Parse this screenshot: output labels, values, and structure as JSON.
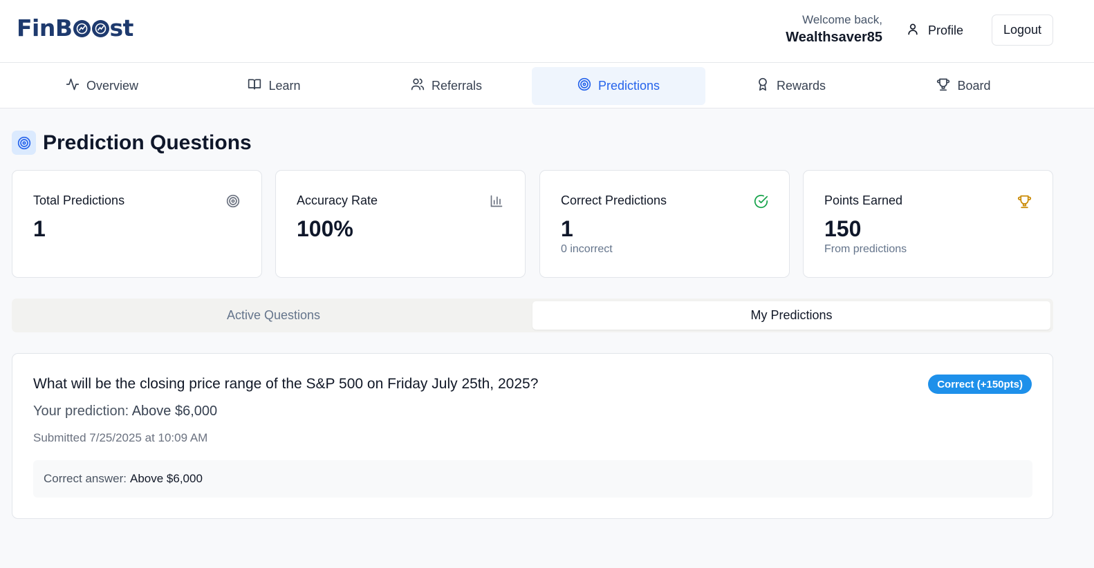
{
  "header": {
    "logo": "FinBoost",
    "welcome_line": "Welcome back,",
    "username": "Wealthsaver85",
    "profile_label": "Profile",
    "logout_label": "Logout"
  },
  "nav": {
    "items": [
      {
        "label": "Overview",
        "icon": "activity-icon"
      },
      {
        "label": "Learn",
        "icon": "book-icon"
      },
      {
        "label": "Referrals",
        "icon": "users-icon"
      },
      {
        "label": "Predictions",
        "icon": "target-icon",
        "active": true
      },
      {
        "label": "Rewards",
        "icon": "award-icon"
      },
      {
        "label": "Board",
        "icon": "trophy-icon"
      }
    ]
  },
  "page": {
    "title": "Prediction Questions",
    "title_icon": "target-icon"
  },
  "stats": [
    {
      "label": "Total Predictions",
      "value": "1",
      "sub": "",
      "icon": "target-icon",
      "icon_color": "#6b7280"
    },
    {
      "label": "Accuracy Rate",
      "value": "100%",
      "sub": "",
      "icon": "bar-chart-icon",
      "icon_color": "#6b7280"
    },
    {
      "label": "Correct Predictions",
      "value": "1",
      "sub": "0 incorrect",
      "icon": "check-circle-icon",
      "icon_color": "#16a34a"
    },
    {
      "label": "Points Earned",
      "value": "150",
      "sub": "From predictions",
      "icon": "trophy-icon",
      "icon_color": "#ca8a04"
    }
  ],
  "tabs": [
    {
      "label": "Active Questions",
      "active": false
    },
    {
      "label": "My Predictions",
      "active": true
    }
  ],
  "prediction": {
    "question": "What will be the closing price range of the S&P 500 on Friday July 25th, 2025?",
    "badge": "Correct (+150pts)",
    "your_prediction_label": "Your prediction:",
    "your_prediction_value": "Above $6,000",
    "submitted": "Submitted 7/25/2025 at 10:09 AM",
    "correct_answer_label": "Correct answer:",
    "correct_answer_value": "Above $6,000"
  },
  "colors": {
    "brand": "#1e3a6e",
    "accent": "#2563eb",
    "badge": "#1e90ea"
  }
}
